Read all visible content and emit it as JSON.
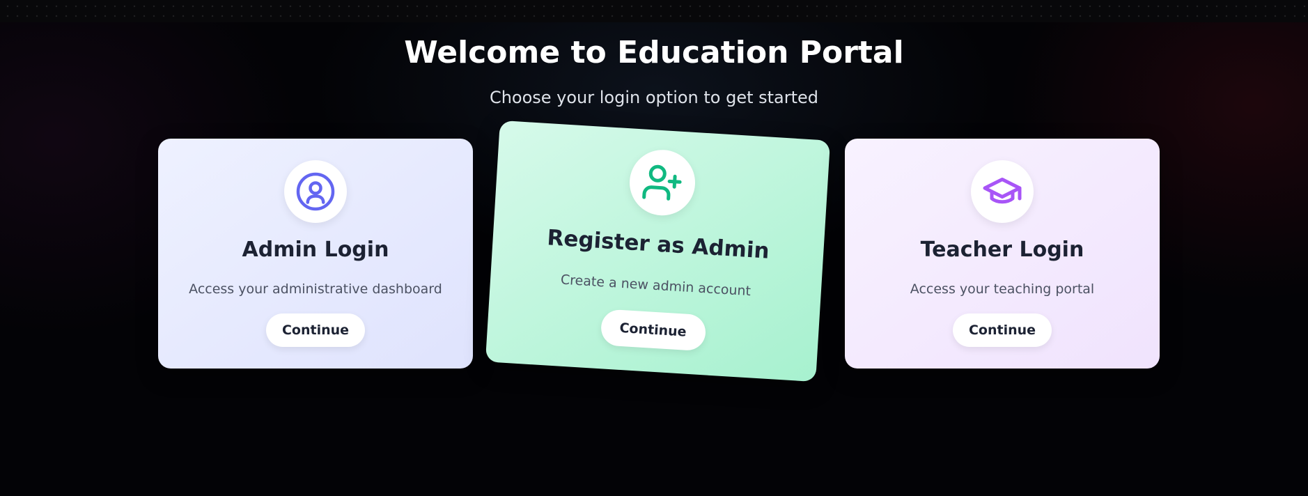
{
  "header": {
    "title": "Welcome to Education Portal",
    "subtitle": "Choose your login option to get started"
  },
  "cards": [
    {
      "title": "Admin Login",
      "description": "Access your administrative dashboard",
      "button_label": "Continue",
      "icon": "user-circle-icon",
      "accent": "#6366f1"
    },
    {
      "title": "Register as Admin",
      "description": "Create a new admin account",
      "button_label": "Continue",
      "icon": "user-plus-icon",
      "accent": "#10b981"
    },
    {
      "title": "Teacher Login",
      "description": "Access your teaching portal",
      "button_label": "Continue",
      "icon": "graduation-cap-icon",
      "accent": "#a855f7"
    }
  ]
}
